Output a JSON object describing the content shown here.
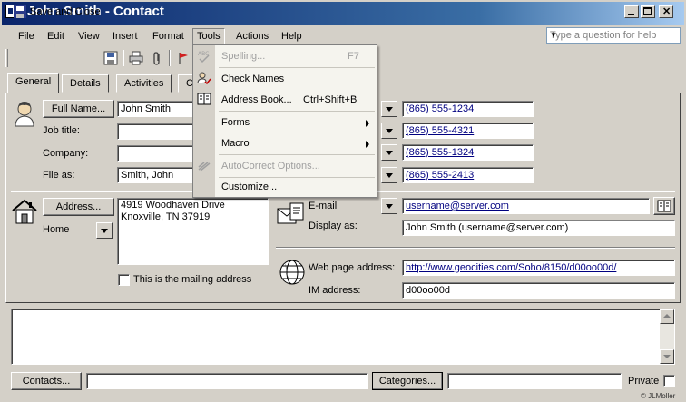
{
  "window": {
    "title": "John Smith - Contact"
  },
  "menubar": {
    "items": [
      "File",
      "Edit",
      "View",
      "Insert",
      "Format",
      "Tools",
      "Actions",
      "Help"
    ],
    "help_placeholder": "Type a question for help"
  },
  "toolbar": {
    "save_close": "Save and Close"
  },
  "tabs": [
    "General",
    "Details",
    "Activities",
    "C"
  ],
  "tools_menu": {
    "items": [
      {
        "label": "Spelling...",
        "shortcut": "F7",
        "disabled": true,
        "icon": "spelling-icon"
      },
      {
        "label": "Check Names",
        "shortcut": "",
        "disabled": false,
        "icon": "check-names-icon"
      },
      {
        "label": "Address Book...",
        "shortcut": "Ctrl+Shift+B",
        "disabled": false,
        "icon": "address-book-icon"
      },
      {
        "label": "Forms",
        "shortcut": "",
        "disabled": false,
        "submenu": true
      },
      {
        "label": "Macro",
        "shortcut": "",
        "disabled": false,
        "submenu": true
      },
      {
        "label": "AutoCorrect Options...",
        "shortcut": "",
        "disabled": true,
        "icon": "autocorrect-icon"
      },
      {
        "label": "Customize...",
        "shortcut": "",
        "disabled": false
      }
    ]
  },
  "general": {
    "full_name_label": "Full Name...",
    "full_name_value": "John Smith",
    "job_title_label": "Job title:",
    "company_label": "Company:",
    "file_as_label": "File as:",
    "file_as_value": "Smith, John",
    "phones": [
      "(865) 555-1234",
      "(865) 555-4321",
      "(865) 555-1324",
      "(865) 555-2413"
    ],
    "address_button": "Address...",
    "address_type": "Home",
    "address_value_line1": "4919 Woodhaven Drive",
    "address_value_line2": "Knoxville, TN  37919",
    "mailing_address_label": "This is the mailing address",
    "email_label": "E-mail",
    "email_value": "username@server.com",
    "display_as_label": "Display as:",
    "display_as_value": "John Smith (username@server.com)",
    "web_label": "Web page address:",
    "web_value": "http://www.geocities.com/Soho/8150/d00oo00d/",
    "im_label": "IM address:",
    "im_value": "d00oo00d"
  },
  "footer": {
    "contacts_button": "Contacts...",
    "categories_button": "Categories...",
    "private_label": "Private",
    "copyright": "© JLMoller"
  }
}
